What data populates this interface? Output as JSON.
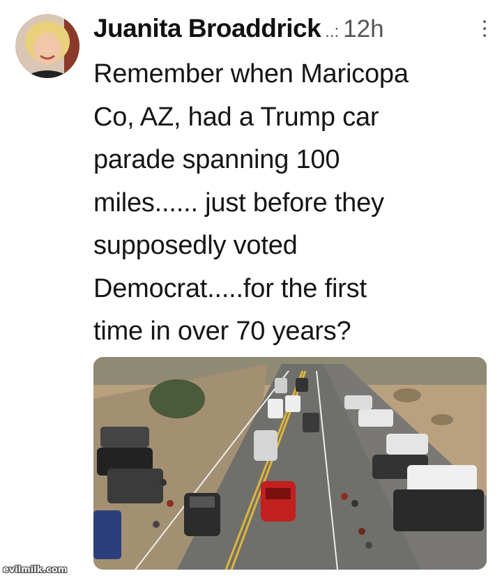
{
  "tweet": {
    "author_name": "Juanita Broaddrick",
    "handle_truncation": "..:",
    "time": "12h",
    "text": "Remember when Maricopa\nCo, AZ, had a Trump car\nparade spanning 100\nmiles...... just before they\nsupposedly voted\nDemocrat.....for the first\ntime in over 70 years?"
  },
  "icons": {
    "more": "vertical-ellipsis-icon"
  },
  "media": {
    "description_icon": "car-parade-photo"
  },
  "watermark": "evilmilk.com",
  "colors": {
    "background": "#ffffff",
    "text": "#151515",
    "muted": "#555555"
  }
}
